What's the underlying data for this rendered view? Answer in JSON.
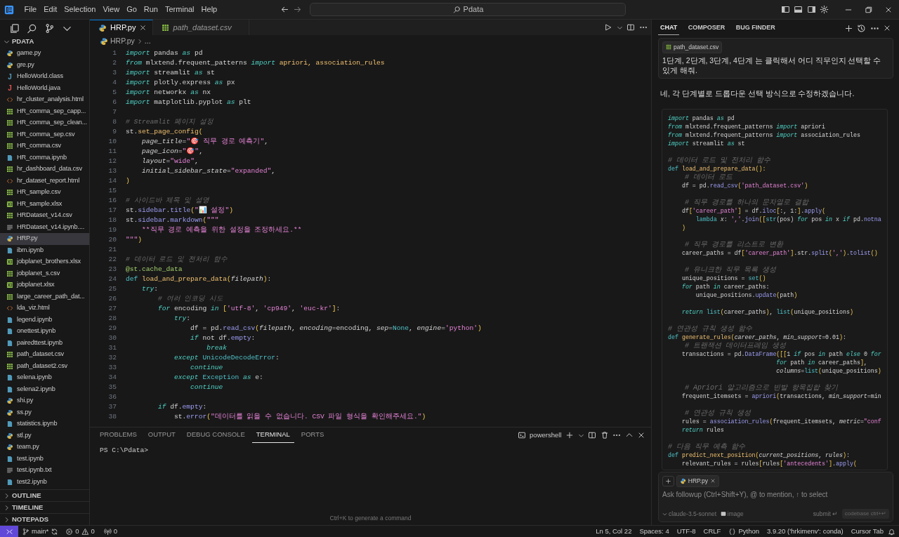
{
  "title_bar": {
    "menus": [
      "File",
      "Edit",
      "Selection",
      "View",
      "Go",
      "Run",
      "Terminal",
      "Help"
    ],
    "search": "Pdata"
  },
  "explorer": {
    "folder": "PDATA",
    "expanded": true,
    "files": [
      {
        "name": "game.py",
        "kind": "py",
        "selected": false
      },
      {
        "name": "gre.py",
        "kind": "py",
        "selected": false
      },
      {
        "name": "HelloWorld.class",
        "kind": "class",
        "glyph": "J",
        "selected": false
      },
      {
        "name": "HelloWorld.java",
        "kind": "java",
        "glyph": "J",
        "selected": false
      },
      {
        "name": "hr_cluster_analysis.html",
        "kind": "html",
        "selected": false
      },
      {
        "name": "HR_comma_sep_capp...",
        "kind": "csv",
        "selected": false
      },
      {
        "name": "HR_comma_sep_clean...",
        "kind": "csv",
        "selected": false
      },
      {
        "name": "HR_comma_sep.csv",
        "kind": "csv",
        "selected": false
      },
      {
        "name": "HR_comma.csv",
        "kind": "csv",
        "selected": false
      },
      {
        "name": "HR_comma.ipynb",
        "kind": "ipynb",
        "selected": false
      },
      {
        "name": "hr_dashboard_data.csv",
        "kind": "csv",
        "selected": false
      },
      {
        "name": "hr_dataset_report.html",
        "kind": "html",
        "selected": false
      },
      {
        "name": "HR_sample.csv",
        "kind": "csv",
        "selected": false
      },
      {
        "name": "HR_sample.xlsx",
        "kind": "xlsx",
        "selected": false
      },
      {
        "name": "HRDataset_v14.csv",
        "kind": "csv",
        "selected": false
      },
      {
        "name": "HRDataset_v14.ipynb....",
        "kind": "txt",
        "selected": false
      },
      {
        "name": "HRP.py",
        "kind": "py",
        "selected": true
      },
      {
        "name": "ibm.ipynb",
        "kind": "ipynb",
        "selected": false
      },
      {
        "name": "jobplanet_brothers.xlsx",
        "kind": "xlsx",
        "selected": false
      },
      {
        "name": "jobplanet_s.csv",
        "kind": "csv",
        "selected": false
      },
      {
        "name": "jobplanet.xlsx",
        "kind": "xlsx",
        "selected": false
      },
      {
        "name": "large_career_path_dat...",
        "kind": "csv",
        "selected": false
      },
      {
        "name": "lda_viz.html",
        "kind": "html",
        "selected": false
      },
      {
        "name": "legend.ipynb",
        "kind": "ipynb",
        "selected": false
      },
      {
        "name": "onettest.ipynb",
        "kind": "ipynb",
        "selected": false
      },
      {
        "name": "pairedttest.ipynb",
        "kind": "ipynb",
        "selected": false
      },
      {
        "name": "path_dataset.csv",
        "kind": "csv",
        "selected": false
      },
      {
        "name": "path_dataset2.csv",
        "kind": "csv",
        "selected": false
      },
      {
        "name": "selena.ipynb",
        "kind": "ipynb",
        "selected": false
      },
      {
        "name": "selena2.ipynb",
        "kind": "ipynb",
        "selected": false
      },
      {
        "name": "shi.py",
        "kind": "py",
        "selected": false
      },
      {
        "name": "ss.py",
        "kind": "py",
        "selected": false
      },
      {
        "name": "statistics.ipynb",
        "kind": "ipynb",
        "selected": false
      },
      {
        "name": "stl.py",
        "kind": "py",
        "selected": false
      },
      {
        "name": "team.py",
        "kind": "py",
        "selected": false
      },
      {
        "name": "test.ipynb",
        "kind": "ipynb",
        "selected": false
      },
      {
        "name": "test.ipynb.txt",
        "kind": "txt",
        "selected": false
      },
      {
        "name": "test2.ipynb",
        "kind": "ipynb",
        "selected": false
      }
    ]
  },
  "sections": [
    {
      "label": "OUTLINE",
      "expanded": false
    },
    {
      "label": "TIMELINE",
      "expanded": false
    },
    {
      "label": "NOTEPADS",
      "expanded": false
    }
  ],
  "editor": {
    "tabs": [
      {
        "label": "HRP.py",
        "kind": "py",
        "selected": true,
        "preview": false
      },
      {
        "label": "path_dataset.csv",
        "kind": "csv",
        "selected": false,
        "preview": true
      }
    ],
    "breadcrumb": [
      "HRP.py",
      "..."
    ],
    "lines": [
      {
        "number": "1",
        "kind": "code",
        "tokens": [
          {
            "text": "import",
            "kind": "kw"
          },
          {
            "text": " pandas ",
            "kind": "txt"
          },
          {
            "text": "as",
            "kind": "kw"
          },
          {
            "text": " pd",
            "kind": "txt"
          }
        ]
      },
      {
        "number": "2",
        "kind": "code",
        "tokens": [
          {
            "text": "from",
            "kind": "kw"
          },
          {
            "text": " mlxtend.frequent_patterns ",
            "kind": "txt"
          },
          {
            "text": "import",
            "kind": "kw"
          },
          {
            "text": " apriori, association_rules",
            "kind": "fn"
          }
        ]
      },
      {
        "number": "3",
        "kind": "code",
        "tokens": [
          {
            "text": "import",
            "kind": "kw"
          },
          {
            "text": " streamlit ",
            "kind": "txt"
          },
          {
            "text": "as",
            "kind": "kw"
          },
          {
            "text": " st",
            "kind": "txt"
          }
        ]
      },
      {
        "number": "4",
        "kind": "code",
        "tokens": [
          {
            "text": "import",
            "kind": "kw"
          },
          {
            "text": " plotly.express ",
            "kind": "txt"
          },
          {
            "text": "as",
            "kind": "kw"
          },
          {
            "text": " px",
            "kind": "txt"
          }
        ]
      },
      {
        "number": "5",
        "kind": "code",
        "tokens": [
          {
            "text": "import",
            "kind": "kw"
          },
          {
            "text": " networkx ",
            "kind": "txt"
          },
          {
            "text": "as",
            "kind": "kw"
          },
          {
            "text": " nx",
            "kind": "txt"
          }
        ]
      },
      {
        "number": "6",
        "kind": "code",
        "tokens": [
          {
            "text": "import",
            "kind": "kw"
          },
          {
            "text": " matplotlib.pyplot ",
            "kind": "txt"
          },
          {
            "text": "as",
            "kind": "kw"
          },
          {
            "text": " plt",
            "kind": "txt"
          }
        ]
      },
      {
        "number": "7",
        "kind": "blank"
      },
      {
        "number": "8",
        "kind": "code",
        "tokens": [
          {
            "text": "# Streamlit 페이지 설정",
            "kind": "cmt"
          }
        ]
      },
      {
        "number": "9",
        "kind": "code",
        "tokens": [
          {
            "text": "st.",
            "kind": "txt"
          },
          {
            "text": "set_page_config",
            "kind": "fn"
          },
          {
            "text": "(",
            "kind": "br"
          }
        ]
      },
      {
        "number": "10",
        "kind": "code",
        "tokens": [
          {
            "text": "    page_title",
            "kind": "param"
          },
          {
            "text": "=",
            "kind": "txt"
          },
          {
            "text": "\"🎯 직무 경로 예측기\"",
            "kind": "str"
          },
          {
            "text": ",",
            "kind": "txt"
          }
        ]
      },
      {
        "number": "11",
        "kind": "code",
        "tokens": [
          {
            "text": "    page_icon",
            "kind": "param"
          },
          {
            "text": "=",
            "kind": "txt"
          },
          {
            "text": "\"🎯\"",
            "kind": "str"
          },
          {
            "text": ",",
            "kind": "txt"
          }
        ]
      },
      {
        "number": "12",
        "kind": "code",
        "tokens": [
          {
            "text": "    layout",
            "kind": "param"
          },
          {
            "text": "=",
            "kind": "txt"
          },
          {
            "text": "\"wide\"",
            "kind": "str"
          },
          {
            "text": ",",
            "kind": "txt"
          }
        ]
      },
      {
        "number": "13",
        "kind": "code",
        "tokens": [
          {
            "text": "    initial_sidebar_state",
            "kind": "param"
          },
          {
            "text": "=",
            "kind": "txt"
          },
          {
            "text": "\"expanded\"",
            "kind": "str"
          },
          {
            "text": ",",
            "kind": "txt"
          }
        ]
      },
      {
        "number": "14",
        "kind": "code",
        "tokens": [
          {
            "text": ")",
            "kind": "br"
          }
        ]
      },
      {
        "number": "15",
        "kind": "blank"
      },
      {
        "number": "16",
        "kind": "code",
        "tokens": [
          {
            "text": "# 사이드바 제목 및 설명",
            "kind": "cmt"
          }
        ]
      },
      {
        "number": "17",
        "kind": "code",
        "tokens": [
          {
            "text": "st.",
            "kind": "txt"
          },
          {
            "text": "sidebar",
            "kind": "attr"
          },
          {
            "text": ".",
            "kind": "txt"
          },
          {
            "text": "title",
            "kind": "attr"
          },
          {
            "text": "(",
            "kind": "br"
          },
          {
            "text": "\"📊 설정\"",
            "kind": "str"
          },
          {
            "text": ")",
            "kind": "br"
          }
        ]
      },
      {
        "number": "18",
        "kind": "code",
        "tokens": [
          {
            "text": "st.",
            "kind": "txt"
          },
          {
            "text": "sidebar",
            "kind": "attr"
          },
          {
            "text": ".",
            "kind": "txt"
          },
          {
            "text": "markdown",
            "kind": "attr"
          },
          {
            "text": "(",
            "kind": "br"
          },
          {
            "text": "\"\"\"",
            "kind": "str"
          }
        ]
      },
      {
        "number": "19",
        "kind": "code",
        "tokens": [
          {
            "text": "    **직무 경로 예측을 위한 설정을 조정하세요.**",
            "kind": "str"
          }
        ]
      },
      {
        "number": "20",
        "kind": "code",
        "tokens": [
          {
            "text": "\"\"\"",
            "kind": "str"
          },
          {
            "text": ")",
            "kind": "br"
          }
        ]
      },
      {
        "number": "21",
        "kind": "blank"
      },
      {
        "number": "22",
        "kind": "code",
        "tokens": [
          {
            "text": "# 데이터 로드 및 전처리 함수",
            "kind": "cmt"
          }
        ]
      },
      {
        "number": "23",
        "kind": "code",
        "tokens": [
          {
            "text": "@st.cache_data",
            "kind": "deco"
          }
        ]
      },
      {
        "number": "24",
        "kind": "code",
        "tokens": [
          {
            "text": "def ",
            "kind": "def"
          },
          {
            "text": "load_and_prepare_data",
            "kind": "fn"
          },
          {
            "text": "(",
            "kind": "br"
          },
          {
            "text": "filepath",
            "kind": "param"
          },
          {
            "text": ")",
            "kind": "br"
          },
          {
            "text": ":",
            "kind": "txt"
          }
        ]
      },
      {
        "number": "25",
        "kind": "code",
        "tokens": [
          {
            "text": "    try",
            "kind": "kw"
          },
          {
            "text": ":",
            "kind": "txt"
          }
        ]
      },
      {
        "number": "26",
        "kind": "code",
        "tokens": [
          {
            "text": "        # 여러 인코딩 시도",
            "kind": "cmt"
          }
        ]
      },
      {
        "number": "27",
        "kind": "code",
        "tokens": [
          {
            "text": "        for",
            "kind": "kw"
          },
          {
            "text": " encoding ",
            "kind": "txt"
          },
          {
            "text": "in",
            "kind": "kw"
          },
          {
            "text": " [",
            "kind": "br"
          },
          {
            "text": "'utf-8'",
            "kind": "str"
          },
          {
            "text": ", ",
            "kind": "txt"
          },
          {
            "text": "'cp949'",
            "kind": "str"
          },
          {
            "text": ", ",
            "kind": "txt"
          },
          {
            "text": "'euc-kr'",
            "kind": "str"
          },
          {
            "text": "]",
            "kind": "br"
          },
          {
            "text": ":",
            "kind": "txt"
          }
        ]
      },
      {
        "number": "28",
        "kind": "code",
        "tokens": [
          {
            "text": "            try",
            "kind": "kw"
          },
          {
            "text": ":",
            "kind": "txt"
          }
        ]
      },
      {
        "number": "29",
        "kind": "code",
        "tokens": [
          {
            "text": "                df = pd.",
            "kind": "txt"
          },
          {
            "text": "read_csv",
            "kind": "attr"
          },
          {
            "text": "(",
            "kind": "br"
          },
          {
            "text": "filepath",
            "kind": "param"
          },
          {
            "text": ", ",
            "kind": "txt"
          },
          {
            "text": "encoding",
            "kind": "param"
          },
          {
            "text": "=encoding, ",
            "kind": "txt"
          },
          {
            "text": "sep",
            "kind": "param"
          },
          {
            "text": "=",
            "kind": "txt"
          },
          {
            "text": "None",
            "kind": "def"
          },
          {
            "text": ", ",
            "kind": "txt"
          },
          {
            "text": "engine",
            "kind": "param"
          },
          {
            "text": "=",
            "kind": "txt"
          },
          {
            "text": "'python'",
            "kind": "str"
          },
          {
            "text": ")",
            "kind": "br"
          }
        ]
      },
      {
        "number": "30",
        "kind": "code",
        "tokens": [
          {
            "text": "                if",
            "kind": "kw"
          },
          {
            "text": " not df.",
            "kind": "txt"
          },
          {
            "text": "empty",
            "kind": "attr"
          },
          {
            "text": ":",
            "kind": "txt"
          }
        ]
      },
      {
        "number": "31",
        "kind": "code",
        "tokens": [
          {
            "text": "                    break",
            "kind": "kw"
          }
        ]
      },
      {
        "number": "32",
        "kind": "code",
        "tokens": [
          {
            "text": "            except",
            "kind": "kw"
          },
          {
            "text": " UnicodeDecodeError",
            "kind": "def"
          },
          {
            "text": ":",
            "kind": "txt"
          }
        ]
      },
      {
        "number": "33",
        "kind": "code",
        "tokens": [
          {
            "text": "                continue",
            "kind": "kw"
          }
        ]
      },
      {
        "number": "34",
        "kind": "code",
        "tokens": [
          {
            "text": "            except",
            "kind": "kw"
          },
          {
            "text": " Exception ",
            "kind": "def"
          },
          {
            "text": "as",
            "kind": "kw"
          },
          {
            "text": " e:",
            "kind": "txt"
          }
        ]
      },
      {
        "number": "35",
        "kind": "code",
        "tokens": [
          {
            "text": "                continue",
            "kind": "kw"
          }
        ]
      },
      {
        "number": "36",
        "kind": "blank"
      },
      {
        "number": "37",
        "kind": "code",
        "tokens": [
          {
            "text": "        if",
            "kind": "kw"
          },
          {
            "text": " df.",
            "kind": "txt"
          },
          {
            "text": "empty",
            "kind": "attr"
          },
          {
            "text": ":",
            "kind": "txt"
          }
        ]
      },
      {
        "number": "38",
        "kind": "code",
        "tokens": [
          {
            "text": "            st.",
            "kind": "txt"
          },
          {
            "text": "error",
            "kind": "attr"
          },
          {
            "text": "(",
            "kind": "br"
          },
          {
            "text": "\"데이터를 읽을 수 없습니다. CSV 파일 형식을 확인해주세요.\"",
            "kind": "str"
          },
          {
            "text": ")",
            "kind": "br"
          }
        ]
      }
    ]
  },
  "panel": {
    "tabs": [
      {
        "label": "PROBLEMS",
        "selected": false
      },
      {
        "label": "OUTPUT",
        "selected": false
      },
      {
        "label": "DEBUG CONSOLE",
        "selected": false
      },
      {
        "label": "TERMINAL",
        "selected": true
      },
      {
        "label": "PORTS",
        "selected": false
      }
    ],
    "shell": "powershell",
    "prompt": "PS C:\\Pdata>",
    "hint": "Ctrl+K to generate a command"
  },
  "chat": {
    "tabs": [
      {
        "label": "CHAT",
        "selected": true
      },
      {
        "label": "COMPOSER",
        "selected": false
      },
      {
        "label": "BUG FINDER",
        "selected": false
      }
    ],
    "message": {
      "attachment": "path_dataset.csv",
      "text": "1단계, 2단계, 3단계, 4단계 는 클릭해서 어디 직무인지 선택할 수 있게 해줘."
    },
    "reply": "네, 각 단계별로 드롭다운 선택 방식으로 수정하겠습니다.",
    "code": [
      {
        "kind": "code",
        "tokens": [
          {
            "text": "import",
            "kind": "kw"
          },
          {
            "text": " pandas ",
            "kind": "txt"
          },
          {
            "text": "as",
            "kind": "kw"
          },
          {
            "text": " pd",
            "kind": "txt"
          }
        ]
      },
      {
        "kind": "code",
        "tokens": [
          {
            "text": "from",
            "kind": "kw"
          },
          {
            "text": " mlxtend.frequent_patterns ",
            "kind": "txt"
          },
          {
            "text": "import",
            "kind": "kw"
          },
          {
            "text": " apriori",
            "kind": "txt"
          }
        ]
      },
      {
        "kind": "code",
        "tokens": [
          {
            "text": "from",
            "kind": "kw"
          },
          {
            "text": " mlxtend.frequent_patterns ",
            "kind": "txt"
          },
          {
            "text": "import",
            "kind": "kw"
          },
          {
            "text": " association_rules",
            "kind": "txt"
          }
        ]
      },
      {
        "kind": "code",
        "tokens": [
          {
            "text": "import",
            "kind": "kw"
          },
          {
            "text": " streamlit ",
            "kind": "txt"
          },
          {
            "text": "as",
            "kind": "kw"
          },
          {
            "text": " st",
            "kind": "txt"
          }
        ]
      },
      {
        "kind": "blank"
      },
      {
        "kind": "code",
        "tokens": [
          {
            "text": "# 데이터 로드 및 전처리 함수",
            "kind": "cmt"
          }
        ]
      },
      {
        "kind": "code",
        "tokens": [
          {
            "text": "def ",
            "kind": "def"
          },
          {
            "text": "load_and_prepare_data",
            "kind": "fn"
          },
          {
            "text": "():",
            "kind": "br"
          }
        ]
      },
      {
        "kind": "code",
        "tokens": [
          {
            "text": "    # 데이터 로드",
            "kind": "cmt"
          }
        ]
      },
      {
        "kind": "code",
        "tokens": [
          {
            "text": "    df = pd.",
            "kind": "txt"
          },
          {
            "text": "read_csv",
            "kind": "attr"
          },
          {
            "text": "(",
            "kind": "br"
          },
          {
            "text": "'path_dataset.csv'",
            "kind": "str"
          },
          {
            "text": ")",
            "kind": "br"
          }
        ]
      },
      {
        "kind": "blank"
      },
      {
        "kind": "code",
        "tokens": [
          {
            "text": "    # 직무 경로를 하나의 문자열로 결합",
            "kind": "cmt"
          }
        ]
      },
      {
        "kind": "code",
        "tokens": [
          {
            "text": "    df",
            "kind": "txt"
          },
          {
            "text": "[",
            "kind": "br"
          },
          {
            "text": "'career_path'",
            "kind": "str"
          },
          {
            "text": "]",
            "kind": "br"
          },
          {
            "text": " = df.",
            "kind": "txt"
          },
          {
            "text": "iloc",
            "kind": "attr"
          },
          {
            "text": "[",
            "kind": "br"
          },
          {
            "text": ":, 1:",
            "kind": "txt"
          },
          {
            "text": "]",
            "kind": "br"
          },
          {
            "text": ".",
            "kind": "txt"
          },
          {
            "text": "apply",
            "kind": "attr"
          },
          {
            "text": "(",
            "kind": "br"
          }
        ]
      },
      {
        "kind": "code",
        "tokens": [
          {
            "text": "        lambda ",
            "kind": "def"
          },
          {
            "text": "x",
            "kind": "param"
          },
          {
            "text": ": ",
            "kind": "txt"
          },
          {
            "text": "','",
            "kind": "str"
          },
          {
            "text": ".",
            "kind": "txt"
          },
          {
            "text": "join",
            "kind": "attr"
          },
          {
            "text": "([",
            "kind": "br"
          },
          {
            "text": "str",
            "kind": "def"
          },
          {
            "text": "(pos) ",
            "kind": "txt"
          },
          {
            "text": "for",
            "kind": "kw"
          },
          {
            "text": " pos ",
            "kind": "txt"
          },
          {
            "text": "in",
            "kind": "kw"
          },
          {
            "text": " x ",
            "kind": "txt"
          },
          {
            "text": "if",
            "kind": "kw"
          },
          {
            "text": " pd.",
            "kind": "txt"
          },
          {
            "text": "notna",
            "kind": "attr"
          }
        ]
      },
      {
        "kind": "code",
        "tokens": [
          {
            "text": "    )",
            "kind": "br"
          }
        ]
      },
      {
        "kind": "blank"
      },
      {
        "kind": "code",
        "tokens": [
          {
            "text": "    # 직무 경로를 리스트로 변환",
            "kind": "cmt"
          }
        ]
      },
      {
        "kind": "code",
        "tokens": [
          {
            "text": "    career_paths = df",
            "kind": "txt"
          },
          {
            "text": "[",
            "kind": "br"
          },
          {
            "text": "'career_path'",
            "kind": "str"
          },
          {
            "text": "]",
            "kind": "br"
          },
          {
            "text": ".str.",
            "kind": "txt"
          },
          {
            "text": "split",
            "kind": "attr"
          },
          {
            "text": "(",
            "kind": "br"
          },
          {
            "text": "','",
            "kind": "str"
          },
          {
            "text": ")",
            "kind": "br"
          },
          {
            "text": ".",
            "kind": "txt"
          },
          {
            "text": "tolist",
            "kind": "attr"
          },
          {
            "text": "()",
            "kind": "br"
          }
        ]
      },
      {
        "kind": "blank"
      },
      {
        "kind": "code",
        "tokens": [
          {
            "text": "    # 유니크한 직무 목록 생성",
            "kind": "cmt"
          }
        ]
      },
      {
        "kind": "code",
        "tokens": [
          {
            "text": "    unique_positions = ",
            "kind": "txt"
          },
          {
            "text": "set",
            "kind": "def"
          },
          {
            "text": "()",
            "kind": "br"
          }
        ]
      },
      {
        "kind": "code",
        "tokens": [
          {
            "text": "    for",
            "kind": "kw"
          },
          {
            "text": " path ",
            "kind": "txt"
          },
          {
            "text": "in",
            "kind": "kw"
          },
          {
            "text": " career_paths:",
            "kind": "txt"
          }
        ]
      },
      {
        "kind": "code",
        "tokens": [
          {
            "text": "        unique_positions.",
            "kind": "txt"
          },
          {
            "text": "update",
            "kind": "attr"
          },
          {
            "text": "(",
            "kind": "br"
          },
          {
            "text": "path",
            "kind": "txt"
          },
          {
            "text": ")",
            "kind": "br"
          }
        ]
      },
      {
        "kind": "blank"
      },
      {
        "kind": "code",
        "tokens": [
          {
            "text": "    return",
            "kind": "kw"
          },
          {
            "text": " list",
            "kind": "def"
          },
          {
            "text": "(",
            "kind": "br"
          },
          {
            "text": "career_paths",
            "kind": "txt"
          },
          {
            "text": ")",
            "kind": "br"
          },
          {
            "text": ", ",
            "kind": "txt"
          },
          {
            "text": "list",
            "kind": "def"
          },
          {
            "text": "(",
            "kind": "br"
          },
          {
            "text": "unique_positions",
            "kind": "txt"
          },
          {
            "text": ")",
            "kind": "br"
          }
        ]
      },
      {
        "kind": "blank"
      },
      {
        "kind": "code",
        "tokens": [
          {
            "text": "# 연관성 규칙 생성 함수",
            "kind": "cmt"
          }
        ]
      },
      {
        "kind": "code",
        "tokens": [
          {
            "text": "def ",
            "kind": "def"
          },
          {
            "text": "generate_rules",
            "kind": "fn"
          },
          {
            "text": "(",
            "kind": "br"
          },
          {
            "text": "career_paths",
            "kind": "param"
          },
          {
            "text": ", ",
            "kind": "txt"
          },
          {
            "text": "min_support",
            "kind": "param"
          },
          {
            "text": "=0.01",
            "kind": "txt"
          },
          {
            "text": ")",
            "kind": "br"
          },
          {
            "text": ":",
            "kind": "txt"
          }
        ]
      },
      {
        "kind": "code",
        "tokens": [
          {
            "text": "    # 트랜잭션 데이터프레임 생성",
            "kind": "cmt"
          }
        ]
      },
      {
        "kind": "code",
        "tokens": [
          {
            "text": "    transactions = pd.",
            "kind": "txt"
          },
          {
            "text": "DataFrame",
            "kind": "attr"
          },
          {
            "text": "([[",
            "kind": "br"
          },
          {
            "text": "1 ",
            "kind": "txt"
          },
          {
            "text": "if",
            "kind": "kw"
          },
          {
            "text": " pos ",
            "kind": "txt"
          },
          {
            "text": "in",
            "kind": "kw"
          },
          {
            "text": " path ",
            "kind": "txt"
          },
          {
            "text": "else",
            "kind": "kw"
          },
          {
            "text": " 0 ",
            "kind": "txt"
          },
          {
            "text": "for",
            "kind": "kw"
          }
        ]
      },
      {
        "kind": "code",
        "tokens": [
          {
            "text": "                               for",
            "kind": "kw"
          },
          {
            "text": " path ",
            "kind": "txt"
          },
          {
            "text": "in",
            "kind": "kw"
          },
          {
            "text": " career_paths",
            "kind": "txt"
          },
          {
            "text": "]",
            "kind": "br"
          },
          {
            "text": ",",
            "kind": "txt"
          }
        ]
      },
      {
        "kind": "code",
        "tokens": [
          {
            "text": "                               columns",
            "kind": "param"
          },
          {
            "text": "=",
            "kind": "txt"
          },
          {
            "text": "list",
            "kind": "def"
          },
          {
            "text": "(",
            "kind": "br"
          },
          {
            "text": "unique_positions",
            "kind": "txt"
          },
          {
            "text": ")",
            "kind": "br"
          }
        ]
      },
      {
        "kind": "blank"
      },
      {
        "kind": "code",
        "tokens": [
          {
            "text": "    # Apriori 알고리즘으로 빈발 항목집합 찾기",
            "kind": "cmt"
          }
        ]
      },
      {
        "kind": "code",
        "tokens": [
          {
            "text": "    frequent_itemsets = ",
            "kind": "txt"
          },
          {
            "text": "apriori",
            "kind": "attr"
          },
          {
            "text": "(",
            "kind": "br"
          },
          {
            "text": "transactions, ",
            "kind": "txt"
          },
          {
            "text": "min_support",
            "kind": "param"
          },
          {
            "text": "=min",
            "kind": "txt"
          }
        ]
      },
      {
        "kind": "blank"
      },
      {
        "kind": "code",
        "tokens": [
          {
            "text": "    # 연관성 규칙 생성",
            "kind": "cmt"
          }
        ]
      },
      {
        "kind": "code",
        "tokens": [
          {
            "text": "    rules = ",
            "kind": "txt"
          },
          {
            "text": "association_rules",
            "kind": "attr"
          },
          {
            "text": "(",
            "kind": "br"
          },
          {
            "text": "frequent_itemsets, ",
            "kind": "txt"
          },
          {
            "text": "metric",
            "kind": "param"
          },
          {
            "text": "=",
            "kind": "txt"
          },
          {
            "text": "\"conf",
            "kind": "str"
          }
        ]
      },
      {
        "kind": "code",
        "tokens": [
          {
            "text": "    return",
            "kind": "kw"
          },
          {
            "text": " rules",
            "kind": "txt"
          }
        ]
      },
      {
        "kind": "blank"
      },
      {
        "kind": "code",
        "tokens": [
          {
            "text": "# 다음 직무 예측 함수",
            "kind": "cmt"
          }
        ]
      },
      {
        "kind": "code",
        "tokens": [
          {
            "text": "def ",
            "kind": "def"
          },
          {
            "text": "predict_next_position",
            "kind": "fn"
          },
          {
            "text": "(",
            "kind": "br"
          },
          {
            "text": "current_positions",
            "kind": "param"
          },
          {
            "text": ", ",
            "kind": "txt"
          },
          {
            "text": "rules",
            "kind": "param"
          },
          {
            "text": ")",
            "kind": "br"
          },
          {
            "text": ":",
            "kind": "txt"
          }
        ]
      },
      {
        "kind": "code",
        "tokens": [
          {
            "text": "    relevant_rules = rules",
            "kind": "txt"
          },
          {
            "text": "[",
            "kind": "br"
          },
          {
            "text": "rules",
            "kind": "txt"
          },
          {
            "text": "[",
            "kind": "br"
          },
          {
            "text": "'antecedents'",
            "kind": "str"
          },
          {
            "text": "]",
            "kind": "br"
          },
          {
            "text": ".",
            "kind": "txt"
          },
          {
            "text": "apply",
            "kind": "attr"
          },
          {
            "text": "(",
            "kind": "br"
          }
        ]
      }
    ],
    "input": {
      "chip": "HRP.py",
      "placeholder": "Ask followup (Ctrl+Shift+Y), @ to mention, ↑ to select",
      "model": "claude-3.5-sonnet",
      "image": "image",
      "submit": "submit ↵",
      "codebase": "codebase ctrl+↵"
    }
  },
  "status_bar": {
    "branch": "main*",
    "errors": "0",
    "warnings": "0",
    "ports": "0",
    "cursor": "Ln 5, Col 22",
    "indent": "Spaces: 4",
    "encoding": "UTF-8",
    "eol": "CRLF",
    "language": "Python",
    "interpreter": "3.9.20 ('hrkimenv': conda)",
    "cursor_tab": "Cursor Tab"
  }
}
